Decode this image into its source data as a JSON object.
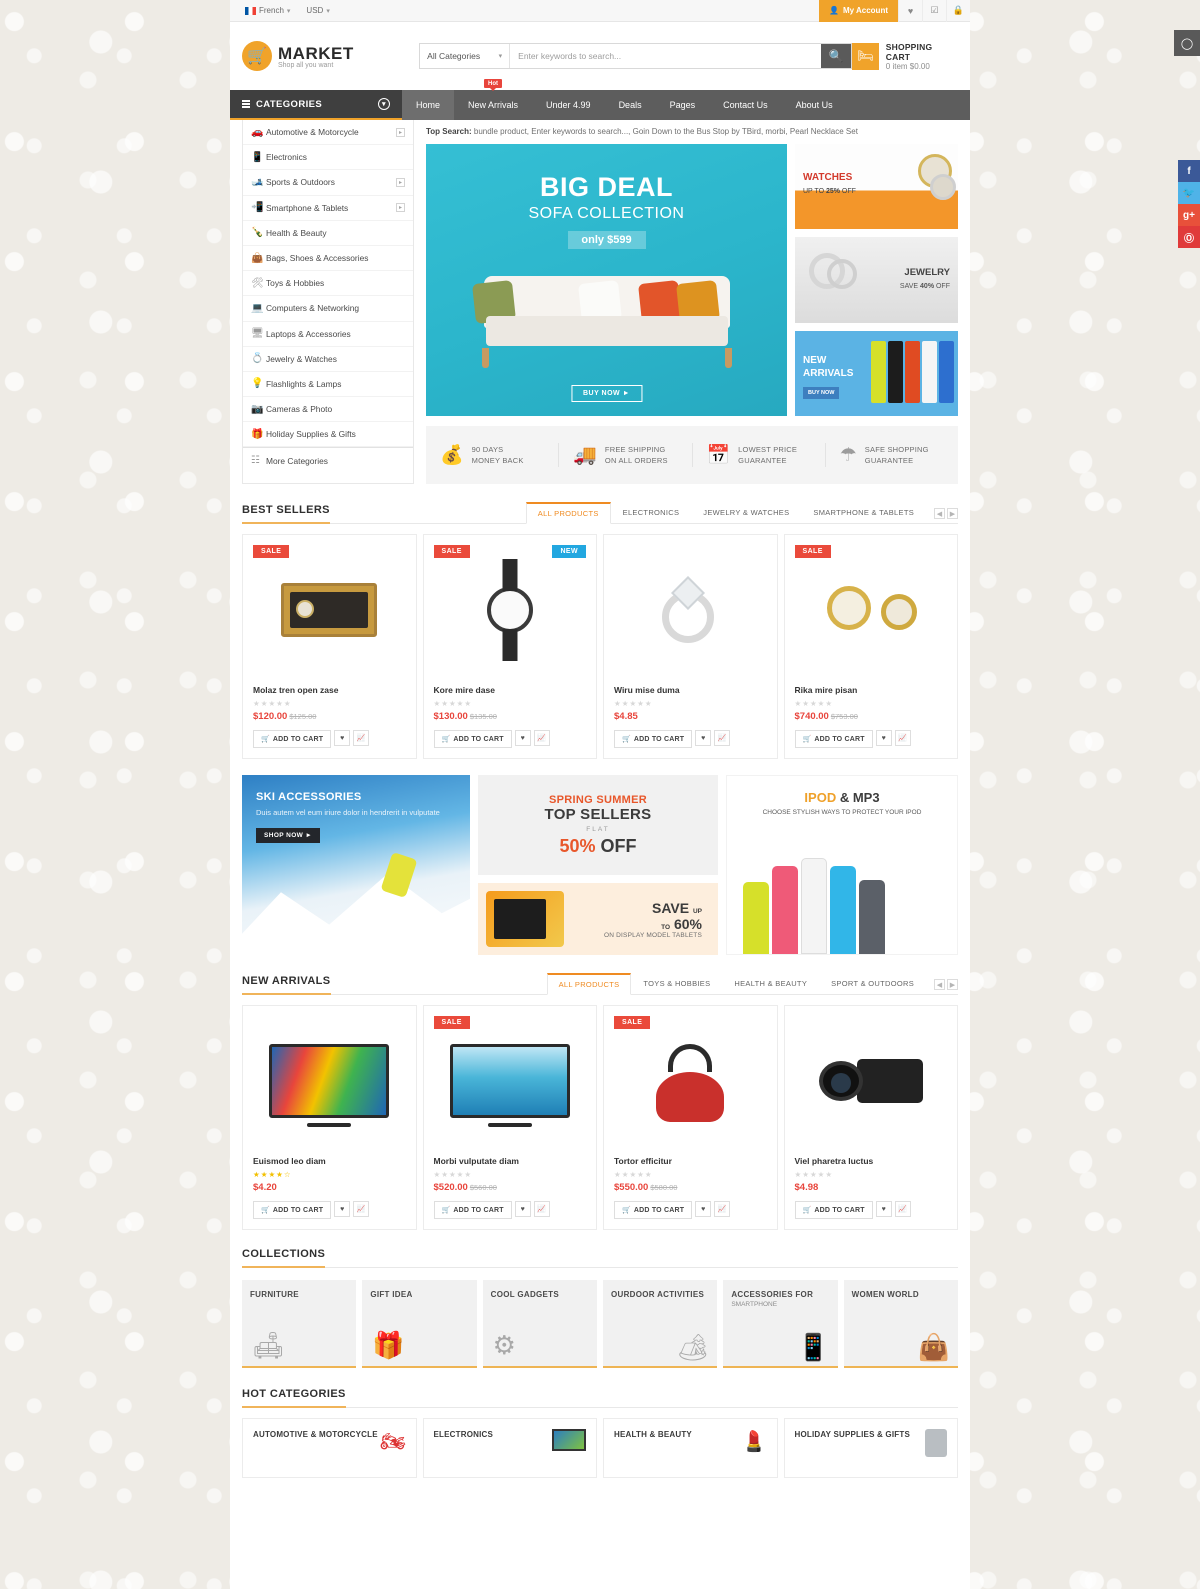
{
  "topbar": {
    "language": "French",
    "currency": "USD",
    "account_label": "My Account",
    "icons": [
      "heart-icon",
      "compare-icon",
      "lock-icon"
    ]
  },
  "header": {
    "brand": "MARKET",
    "tagline": "Shop all you want",
    "search": {
      "category": "All Categories",
      "placeholder": "Enter keywords to search...",
      "value": ""
    },
    "cart": {
      "title": "SHOPPING CART",
      "summary": "0 item $0.00"
    }
  },
  "nav": {
    "categories_label": "CATEGORIES",
    "items": [
      {
        "label": "Home",
        "active": true,
        "badge": ""
      },
      {
        "label": "New Arrivals",
        "active": false,
        "badge": "Hot"
      },
      {
        "label": "Under 4.99",
        "active": false,
        "badge": ""
      },
      {
        "label": "Deals",
        "active": false,
        "badge": ""
      },
      {
        "label": "Pages",
        "active": false,
        "badge": ""
      },
      {
        "label": "Contact Us",
        "active": false,
        "badge": ""
      },
      {
        "label": "About Us",
        "active": false,
        "badge": ""
      }
    ]
  },
  "sidebar": {
    "items": [
      {
        "label": "Automotive & Motorcycle",
        "icon": "car-icon",
        "arrow": true
      },
      {
        "label": "Electronics",
        "icon": "radio-icon",
        "arrow": false
      },
      {
        "label": "Sports & Outdoors",
        "icon": "ski-icon",
        "arrow": true
      },
      {
        "label": "Smartphone & Tablets",
        "icon": "phone-icon",
        "arrow": true
      },
      {
        "label": "Health & Beauty",
        "icon": "bottle-icon",
        "arrow": false
      },
      {
        "label": "Bags, Shoes & Accessories",
        "icon": "bag-icon",
        "arrow": false
      },
      {
        "label": "Toys & Hobbies",
        "icon": "toy-icon",
        "arrow": false
      },
      {
        "label": "Computers & Networking",
        "icon": "monitor-icon",
        "arrow": false
      },
      {
        "label": "Laptops & Accessories",
        "icon": "laptop-icon",
        "arrow": false
      },
      {
        "label": "Jewelry & Watches",
        "icon": "ring-icon",
        "arrow": false
      },
      {
        "label": "Flashlights & Lamps",
        "icon": "flashlight-icon",
        "arrow": false
      },
      {
        "label": "Cameras & Photo",
        "icon": "camera-icon",
        "arrow": false
      },
      {
        "label": "Holiday Supplies & Gifts",
        "icon": "gift-icon",
        "arrow": false
      },
      {
        "label": "More Categories",
        "icon": "grid-icon",
        "arrow": false
      }
    ]
  },
  "top_search": {
    "label": "Top Search:",
    "terms": "bundle product,  Enter keywords to search...,  Goin Down to the Bus Stop by TBird,  morbi,  Pearl Necklace Set"
  },
  "hero": {
    "title": "BIG DEAL",
    "subtitle": "SOFA COLLECTION",
    "price": "only $599",
    "cta": "BUY NOW ►"
  },
  "promos": [
    {
      "name": "watches",
      "title": "WATCHES",
      "sub1": "UP TO ",
      "strong": "25%",
      "sub2": " OFF"
    },
    {
      "name": "jewelry",
      "title": "JEWELRY",
      "sub1": "SAVE ",
      "strong": "40%",
      "sub2": " OFF"
    },
    {
      "name": "new-arrivals",
      "title": "NEW",
      "title2": "ARRIVALS",
      "cta": "BUY NOW"
    }
  ],
  "services": [
    {
      "icon": "moneybag-icon",
      "line1": "90 DAYS",
      "line2": "MONEY BACK"
    },
    {
      "icon": "truck-icon",
      "line1": "FREE SHIPPING",
      "line2": "ON ALL ORDERS"
    },
    {
      "icon": "calendar-icon",
      "line1": "LOWEST PRICE",
      "line2": "GUARANTEE"
    },
    {
      "icon": "umbrella-icon",
      "line1": "SAFE SHOPPING",
      "line2": "GUARANTEE"
    }
  ],
  "best_sellers": {
    "title": "BEST SELLERS",
    "tabs": [
      {
        "label": "ALL PRODUCTS",
        "active": true
      },
      {
        "label": "ELECTRONICS",
        "active": false
      },
      {
        "label": "JEWELRY & WATCHES",
        "active": false
      },
      {
        "label": "SMARTPHONE & TABLETS",
        "active": false
      }
    ],
    "products": [
      {
        "name": "Molaz tren open zase",
        "price": "$120.00",
        "old_price": "$125.00",
        "rating": 0,
        "badges": [
          "SALE"
        ],
        "add_to_cart": "ADD TO CART",
        "image": "watch-box"
      },
      {
        "name": "Kore mire dase",
        "price": "$130.00",
        "old_price": "$135.00",
        "rating": 0,
        "badges": [
          "SALE",
          "NEW"
        ],
        "add_to_cart": "ADD TO CART",
        "image": "wrist-watch"
      },
      {
        "name": "Wiru mise duma",
        "price": "$4.85",
        "old_price": "",
        "rating": 0,
        "badges": [],
        "add_to_cart": "ADD TO CART",
        "image": "diamond-ring"
      },
      {
        "name": "Rika mire pisan",
        "price": "$740.00",
        "old_price": "$753.00",
        "rating": 0,
        "badges": [
          "SALE"
        ],
        "add_to_cart": "ADD TO CART",
        "image": "gold-watches"
      }
    ]
  },
  "mid_banners": {
    "ski": {
      "title": "SKI ACCESSORIES",
      "text": "Duis autem vel eum iriure dolor in hendrerit in vulputate",
      "cta": "SHOP NOW ►"
    },
    "top_sellers": {
      "l1": "SPRING SUMMER",
      "l2": "TOP SELLERS",
      "l3": "FLAT",
      "l4_pct": "50%",
      "l4_off": " OFF"
    },
    "save": {
      "s1": "SAVE",
      "up": "UP",
      "to": "TO",
      "pct": "60%",
      "s2": "ON DISPLAY MODEL TABLETS"
    },
    "ipod": {
      "t1a": "IPOD",
      "t1b": " & MP3",
      "t2": "CHOOSE STYLISH WAYS TO PROTECT YOUR IPOD"
    }
  },
  "new_arrivals": {
    "title": "NEW ARRIVALS",
    "tabs": [
      {
        "label": "ALL PRODUCTS",
        "active": true
      },
      {
        "label": "TOYS & HOBBIES",
        "active": false
      },
      {
        "label": "HEALTH & BEAUTY",
        "active": false
      },
      {
        "label": "SPORT & OUTDOORS",
        "active": false
      }
    ],
    "products": [
      {
        "name": "Euismod leo diam",
        "price": "$4.20",
        "old_price": "",
        "rating": 4.5,
        "badges": [],
        "add_to_cart": "ADD TO CART",
        "image": "curved-tv"
      },
      {
        "name": "Morbi vulputate diam",
        "price": "$520.00",
        "old_price": "$560.00",
        "rating": 0,
        "badges": [
          "SALE"
        ],
        "add_to_cart": "ADD TO CART",
        "image": "flat-tv"
      },
      {
        "name": "Tortor efficitur",
        "price": "$550.00",
        "old_price": "$580.00",
        "rating": 0,
        "badges": [
          "SALE"
        ],
        "add_to_cart": "ADD TO CART",
        "image": "red-kettle"
      },
      {
        "name": "Viel pharetra luctus",
        "price": "$4.98",
        "old_price": "",
        "rating": 0,
        "badges": [],
        "add_to_cart": "ADD TO CART",
        "image": "camcorder"
      }
    ]
  },
  "collections": {
    "title": "COLLECTIONS",
    "items": [
      {
        "label": "FURNITURE",
        "sub": "",
        "icon": "sofa-icon"
      },
      {
        "label": "GIFT IDEA",
        "sub": "",
        "icon": "gift-icon"
      },
      {
        "label": "COOL GADGETS",
        "sub": "",
        "icon": "gear-icon"
      },
      {
        "label": "OURDOOR ACTIVITIES",
        "sub": "",
        "icon": "camping-icon"
      },
      {
        "label": "ACCESSORIES FOR",
        "sub": "SMARTPHONE",
        "icon": "devices-icon"
      },
      {
        "label": "WOMEN WORLD",
        "sub": "",
        "icon": "fashion-icon"
      }
    ]
  },
  "hot_categories": {
    "title": "HOT CATEGORIES",
    "items": [
      {
        "label": "AUTOMOTIVE & MOTORCYCLE",
        "icon": "motorcycle-icon"
      },
      {
        "label": "ELECTRONICS",
        "icon": "tv-icon"
      },
      {
        "label": "HEALTH & BEAUTY",
        "icon": "cosmetics-icon"
      },
      {
        "label": "HOLIDAY SUPPLIES & GIFTS",
        "icon": "shirt-icon"
      }
    ]
  },
  "social": [
    {
      "name": "facebook",
      "glyph": "f",
      "color": "#3b5998"
    },
    {
      "name": "twitter",
      "glyph": "ᴠ",
      "color": "#4fb3e8"
    },
    {
      "name": "googleplus",
      "glyph": "g+",
      "color": "#e8503a"
    },
    {
      "name": "pinterest",
      "glyph": "Ⓟ",
      "color": "#e03a3a"
    }
  ],
  "skin_switcher": {
    "icon": "palette-icon"
  },
  "colors": {
    "accent": "#f0a32a",
    "sale": "#e8453c",
    "new": "#22a7e0",
    "price": "#e8453c",
    "nav_bg": "#5d5d5d"
  }
}
